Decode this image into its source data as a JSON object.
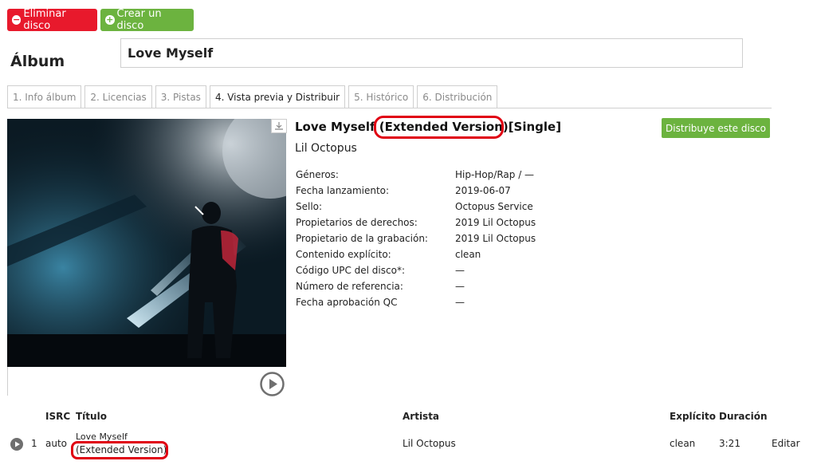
{
  "toolbar": {
    "delete_label": "Eliminar disco",
    "create_label": "Crear un disco"
  },
  "album": {
    "label": "Álbum",
    "name": "Love Myself"
  },
  "tabs": [
    {
      "label": "1. Info álbum",
      "active": false
    },
    {
      "label": "2. Licencias",
      "active": false
    },
    {
      "label": "3. Pistas",
      "active": false
    },
    {
      "label": "4. Vista previa y Distribuir",
      "active": true
    },
    {
      "label": "5. Histórico",
      "active": false
    },
    {
      "label": "6. Distribución",
      "active": false
    }
  ],
  "preview": {
    "title_main": "Love Myself",
    "title_version": "(Extended Version)",
    "title_type": "[Single]",
    "artist": "Lil Octopus",
    "distribute_label": "Distribuye este disco",
    "details": [
      {
        "key": "Géneros:",
        "value": "Hip-Hop/Rap / —"
      },
      {
        "key": "Fecha lanzamiento:",
        "value": "2019-06-07"
      },
      {
        "key": "Sello:",
        "value": "Octopus Service"
      },
      {
        "key": "Propietarios de derechos:",
        "value": "2019 Lil Octopus"
      },
      {
        "key": "Propietario de la grabación:",
        "value": "2019 Lil Octopus"
      },
      {
        "key": "Contenido explícito:",
        "value": "clean"
      },
      {
        "key": "Código UPC del disco*:",
        "value": "—"
      },
      {
        "key": "Número de referencia:",
        "value": "—"
      },
      {
        "key": "Fecha aprobación QC",
        "value": "—"
      }
    ]
  },
  "tracks": {
    "headers": {
      "isrc": "ISRC",
      "title": "Título",
      "artist": "Artista",
      "explicit": "Explícito",
      "duration": "Duración"
    },
    "rows": [
      {
        "number": "1",
        "isrc": "auto",
        "title": "Love Myself",
        "version": "(Extended Version)",
        "artist": "Lil Octopus",
        "explicit": "clean",
        "duration": "3:21",
        "edit_label": "Editar"
      }
    ]
  },
  "colors": {
    "delete": "#e8192c",
    "create": "#6cb33f",
    "distribute": "#6cb33f",
    "highlight": "#e00012"
  }
}
